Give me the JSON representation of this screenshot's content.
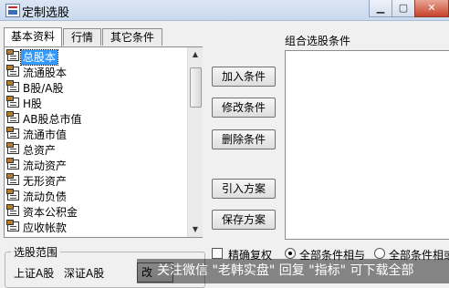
{
  "window": {
    "title": "定制选股"
  },
  "tabs": [
    {
      "label": "基本资料",
      "active": true
    },
    {
      "label": "行情"
    },
    {
      "label": "其它条件"
    }
  ],
  "list": {
    "items": [
      {
        "label": "总股本",
        "selected": true
      },
      {
        "label": "流通股本"
      },
      {
        "label": "B股/A股"
      },
      {
        "label": "H股"
      },
      {
        "label": "AB股总市值"
      },
      {
        "label": "流通市值"
      },
      {
        "label": "总资产"
      },
      {
        "label": "流动资产"
      },
      {
        "label": "无形资产"
      },
      {
        "label": "流动负债"
      },
      {
        "label": "资本公积金"
      },
      {
        "label": "应收帐款"
      }
    ]
  },
  "buttons": {
    "add": "加入条件",
    "modify": "修改条件",
    "delete": "删除条件",
    "import": "引入方案",
    "save": "保存方案"
  },
  "conditions": {
    "label": "组合选股条件"
  },
  "range": {
    "legend": "选股范围",
    "value_a": "上证A股",
    "value_b": "深证A股",
    "partial_button": "改"
  },
  "options": {
    "checkbox_label": "精确复权",
    "radio1_label": "全部条件相与",
    "radio2_label": "全部条件相或"
  },
  "overlay": {
    "text": "关注微信 \"老韩实盘\" 回复 \"指标\" 可下载全部"
  },
  "colors": {
    "selection": "#3399ff",
    "titlebar": "#c9d9ee",
    "close": "#c7432c"
  }
}
